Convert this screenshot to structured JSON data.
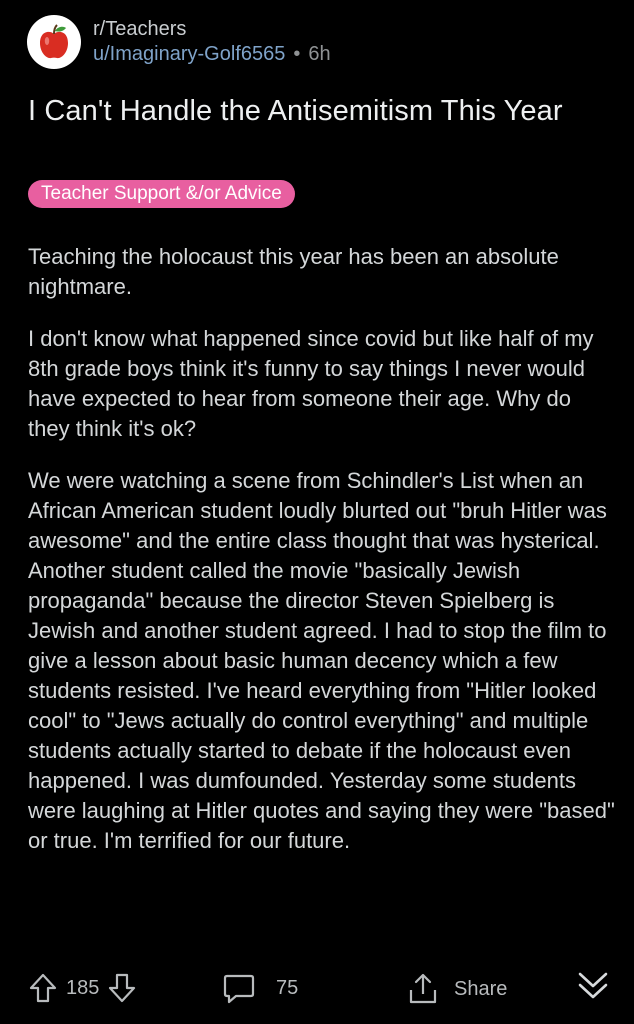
{
  "header": {
    "subreddit": "r/Teachers",
    "username": "u/Imaginary-Golf6565",
    "separator": "•",
    "time": "6h",
    "avatar_icon": "apple-icon"
  },
  "post": {
    "title": "I Can't Handle the Antisemitism This Year",
    "flair": "Teacher Support &/or Advice",
    "flair_color": "#e85fa0",
    "paragraphs": [
      "Teaching the holocaust this year has been an absolute nightmare.",
      "I don't know what happened since covid but like half of my 8th grade boys think it's funny to say things I never would have expected to hear from someone their age. Why do they think it's ok?",
      "We were watching a scene from Schindler's List when an African American student loudly blurted out \"bruh Hitler was awesome\" and the entire class thought that was hysterical. Another student called the movie \"basically Jewish propaganda\" because the director Steven Spielberg is Jewish and another student agreed. I had to stop the film to give a lesson about basic human decency which a few students resisted. I've heard everything from \"Hitler looked cool\" to \"Jews actually do control everything\" and multiple students actually started to debate if the holocaust even happened. I was dumfounded. Yesterday some students were laughing at Hitler quotes and saying they were \"based\" or true. I'm terrified for our future."
    ]
  },
  "actions": {
    "votes": "185",
    "comments": "75",
    "share_label": "Share",
    "icons": [
      "upvote-icon",
      "downvote-icon",
      "comment-icon",
      "share-icon",
      "chevron-down-double-icon"
    ]
  }
}
